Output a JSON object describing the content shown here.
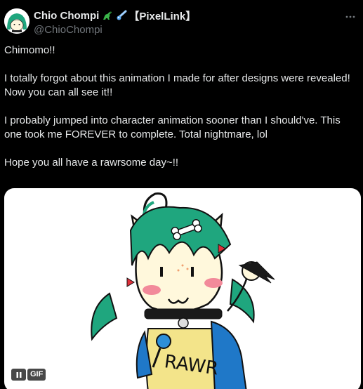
{
  "author": {
    "display_name": "Chio Chompi",
    "tag": "【PixelLink】",
    "handle": "@ChioChompi",
    "emoji_icons": [
      "dinosaur-icon",
      "comet-icon"
    ]
  },
  "more_icon": "more-options-icon",
  "body": {
    "paragraphs": [
      "Chimomo!!",
      "I totally forgot about this animation I made for after designs were revealed! Now you can all see it!!",
      "I probably jumped into character animation sooner than I should've. This one took me FOREVER to complete. Total nightmare, lol",
      "Hope you all have a rawrsome day~!!"
    ]
  },
  "media": {
    "type": "gif",
    "badge": "GIF",
    "drawing_text": "RAWR",
    "pause_icon": "pause-icon"
  },
  "colors": {
    "background": "#000000",
    "text": "#e7e9ea",
    "secondary_text": "#71767b",
    "hair_green": "#1fa67e",
    "accent_blue": "#1f78c8"
  }
}
